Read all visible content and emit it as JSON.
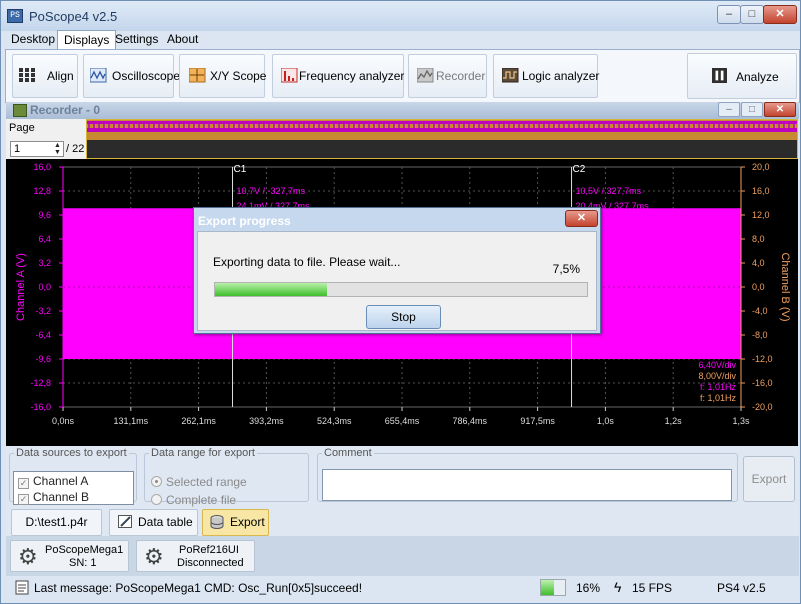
{
  "app": {
    "title": "PoScope4 v2.5",
    "icon_text": "PS",
    "window_buttons": {
      "minimize": "–",
      "maximize": "□",
      "close": "✕"
    }
  },
  "menu": [
    "Desktop",
    "Displays",
    "Settings",
    "About"
  ],
  "toolbar": {
    "buttons": [
      {
        "label": "Align",
        "icon": "grid-icon"
      },
      {
        "label": "Oscilloscope",
        "icon": "oscilloscope-icon"
      },
      {
        "label": "X/Y Scope",
        "icon": "xy-scope-icon"
      },
      {
        "label": "Frequency analyzer",
        "icon": "frequency-analyzer-icon"
      },
      {
        "label": "Recorder",
        "icon": "recorder-icon"
      },
      {
        "label": "Logic analyzer",
        "icon": "logic-analyzer-icon"
      }
    ],
    "analyze": "Analyze"
  },
  "recorder": {
    "title": "Recorder - 0",
    "page_label": "Page",
    "page_value": "1",
    "page_total": "/ 22"
  },
  "colors": {
    "channel_a": "#ff00ff",
    "channel_b": "#f0a060",
    "overview_a": "#c000c0",
    "overview_b": "#c88a30",
    "background": "#000000",
    "grid": "#555555"
  },
  "chart_data": {
    "type": "line",
    "xlabel": "",
    "ylabel_left": "Channel A (V)",
    "ylabel_right": "Channel B (V)",
    "x_ticks": [
      "0,0ns",
      "131,1ms",
      "262,1ms",
      "393,2ms",
      "524,3ms",
      "655,4ms",
      "786,4ms",
      "917,5ms",
      "1,0s",
      "1,2s",
      "1,3s"
    ],
    "x_tick_values": [
      0,
      0.1311,
      0.2621,
      0.3932,
      0.5243,
      0.6554,
      0.7864,
      0.9175,
      1.0486,
      1.1796,
      1.3107
    ],
    "xlim": [
      0,
      1.3107
    ],
    "y_ticks_left": [
      "16,0",
      "12,8",
      "9,6",
      "6,4",
      "3,2",
      "0,0",
      "-3,2",
      "-6,4",
      "-9,6",
      "-12,8",
      "-16,0"
    ],
    "y_ticks_right": [
      "20,0",
      "16,0",
      "12,0",
      "8,0",
      "4,0",
      "0,0",
      "-4,0",
      "-8,0",
      "-12,0",
      "-16,0",
      "-20,0"
    ],
    "ylim_left": [
      -16,
      16
    ],
    "ylim_right": [
      -20,
      20
    ],
    "series": [
      {
        "name": "Channel A",
        "high": 10.5,
        "low": -9.6,
        "x_start": 0,
        "x_end": 1.3107
      }
    ],
    "cursors": [
      {
        "label": "C1",
        "x": 0.3277,
        "line1": "10,7V / -327,7ms",
        "line2": "24,1mV / 327,7ms"
      },
      {
        "label": "C2",
        "x": 0.9831,
        "line1": "10,5V / 327,7ms",
        "line2": "20,4mV / 327,7ms"
      }
    ],
    "info": [
      "6,40V/div",
      "8,00V/div",
      "f: 1,01Hz",
      "f: 1,01Hz"
    ]
  },
  "export_panel": {
    "sources_title": "Data sources to export",
    "channel_a": "Channel A",
    "channel_b": "Channel B",
    "range_title": "Data range for export",
    "selected_range": "Selected range",
    "complete_file": "Complete file",
    "comment_title": "Comment",
    "export_button": "Export"
  },
  "file_tabs": {
    "file": "D:\\test1.p4r",
    "data_table": "Data table",
    "export": "Export"
  },
  "devices": [
    {
      "name": "PoScopeMega1",
      "status": "SN: 1"
    },
    {
      "name": "PoRef216UI",
      "status": "Disconnected"
    }
  ],
  "status": {
    "message": "Last message: PoScopeMega1 CMD: Osc_Run[0x5]",
    "result": "succeed!",
    "cpu": "16%",
    "cpu_fraction": 0.16,
    "fps": "15 FPS",
    "version": "PS4 v2.5"
  },
  "dialog": {
    "title": "Export progress",
    "close": "✕",
    "message": "Exporting data to file. Please wait...",
    "percent": "7,5%",
    "progress_fraction": 0.075,
    "stop": "Stop"
  }
}
